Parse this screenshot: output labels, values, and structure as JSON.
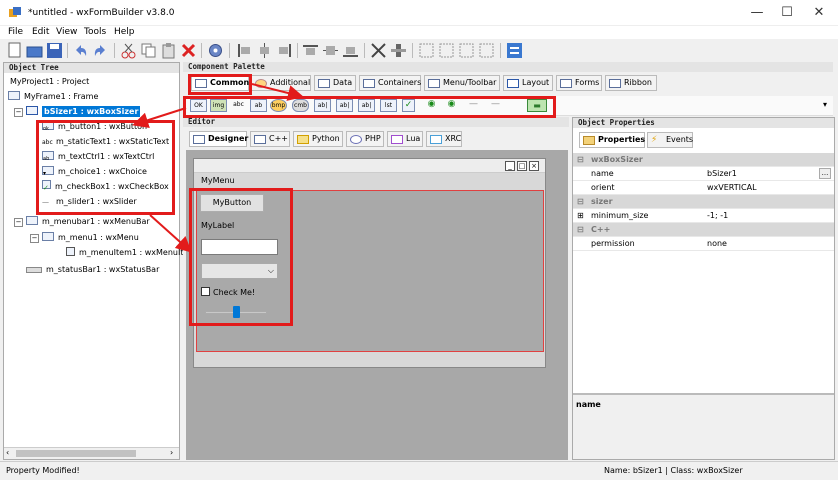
{
  "window": {
    "title": "*untitled - wxFormBuilder v3.8.0",
    "minimize": "—",
    "maximize": "☐",
    "close": "✕"
  },
  "menu": [
    "File",
    "Edit",
    "View",
    "Tools",
    "Help"
  ],
  "tree": {
    "header": "Object Tree",
    "project": "MyProject1 : Project",
    "frame": "MyFrame1 : Frame",
    "sizer": "bSizer1 : wxBoxSizer",
    "children": [
      {
        "label": "m_button1 : wxButton",
        "icon": "ok"
      },
      {
        "label": "m_staticText1 : wxStaticText",
        "icon": "abc"
      },
      {
        "label": "m_textCtrl1 : wxTextCtrl",
        "icon": "ab"
      },
      {
        "label": "m_choice1 : wxChoice",
        "icon": "▾"
      },
      {
        "label": "m_checkBox1 : wxCheckBox",
        "icon": "✓"
      },
      {
        "label": "m_slider1 : wxSlider",
        "icon": "—"
      }
    ],
    "menubar": "m_menubar1 : wxMenuBar",
    "menu": "m_menu1 : wxMenu",
    "menuitem": "m_menuItem1 : wxMenuItem",
    "statusbar": "m_statusBar1 : wxStatusBar"
  },
  "palette": {
    "header": "Component Palette",
    "tabs": [
      "Common",
      "Additional",
      "Data",
      "Containers",
      "Menu/Toolbar",
      "Layout",
      "Forms",
      "Ribbon"
    ],
    "icons": [
      "OK",
      "img",
      "abc",
      "ab",
      "bmp",
      "cmb",
      "ab|",
      "ab|",
      "ab|",
      "lst",
      "✓",
      "◉",
      "◉",
      "—",
      "—",
      "▬"
    ]
  },
  "editor": {
    "header": "Editor",
    "tabs": [
      "Designer",
      "C++",
      "Python",
      "PHP",
      "Lua",
      "XRC"
    ],
    "frame_menu": "MyMenu",
    "button_label": "MyButton",
    "static_label": "MyLabel",
    "text_value": "",
    "choice_value": "",
    "checkbox_label": "Check Me!",
    "slider_value": 0.5
  },
  "props": {
    "header": "Object Properties",
    "tabs": [
      "Properties",
      "Events"
    ],
    "class_name": "wxBoxSizer",
    "rows": [
      {
        "key": "name",
        "value": "bSizer1"
      },
      {
        "key": "orient",
        "value": "wxVERTICAL"
      }
    ],
    "cat_sizer": "sizer",
    "min_size_key": "minimum_size",
    "min_size_val": "-1; -1",
    "cat_cpp": "C++",
    "perm_key": "permission",
    "perm_val": "none",
    "desc_title": "name"
  },
  "status": {
    "left": "Property Modified!",
    "right": "Name: bSizer1 | Class: wxBoxSizer"
  },
  "colors": {
    "selection": "#0078d7",
    "highlight_box": "#e21b1b"
  }
}
